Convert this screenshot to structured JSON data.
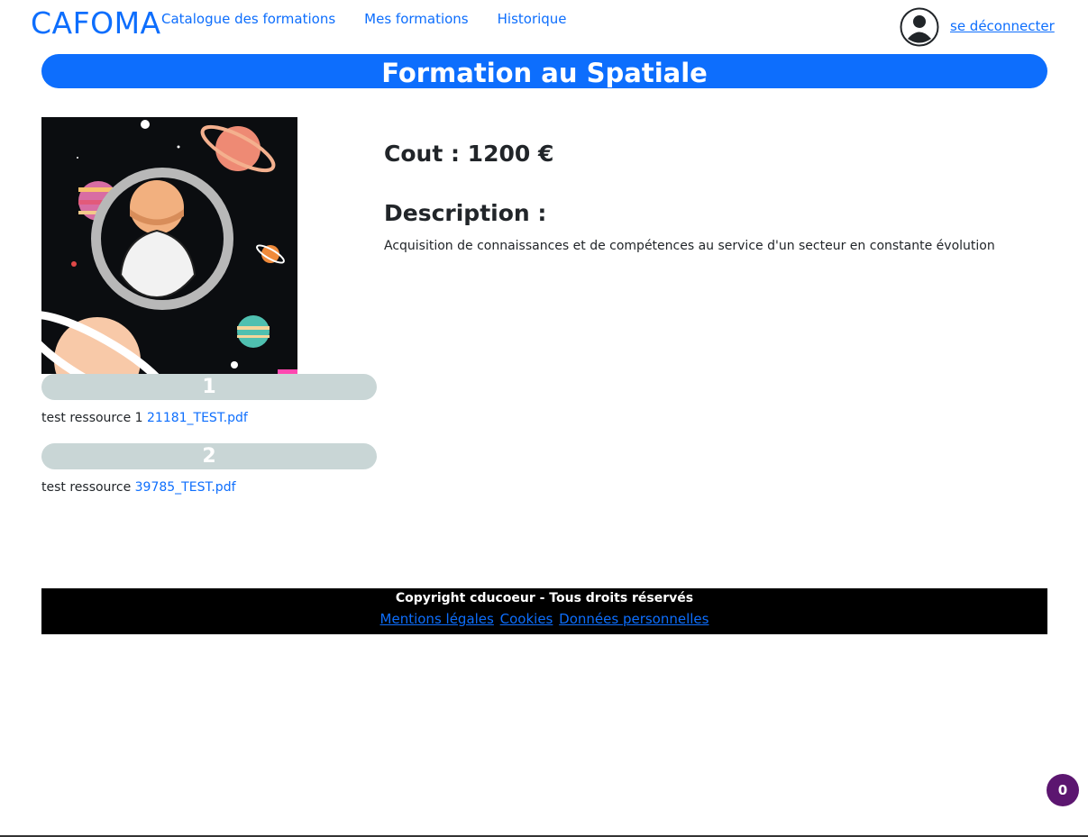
{
  "header": {
    "brand": "CAFOMA",
    "nav": [
      "Catalogue des formations",
      "Mes formations",
      "Historique"
    ],
    "logout": "se déconnecter"
  },
  "page": {
    "title": "Formation au Spatiale"
  },
  "resources": [
    {
      "number": "1",
      "label": "test ressource 1",
      "file": "21181_TEST.pdf"
    },
    {
      "number": "2",
      "label": "test ressource",
      "file": "39785_TEST.pdf"
    }
  ],
  "details": {
    "cost": "Cout : 1200 €",
    "description_heading": "Description :",
    "description": "Acquisition de connaissances et de compétences au service d'un secteur en constante évolution"
  },
  "footer": {
    "copyright": "Copyright cducoeur - Tous droits réservés",
    "links": [
      "Mentions légales",
      "Cookies",
      "Données personnelles"
    ]
  },
  "badge": {
    "count": "0"
  },
  "colors": {
    "primary": "#0d6efd",
    "resource_bar": "#c9d6d6",
    "badge": "#5c1670",
    "footer": "#000000"
  }
}
